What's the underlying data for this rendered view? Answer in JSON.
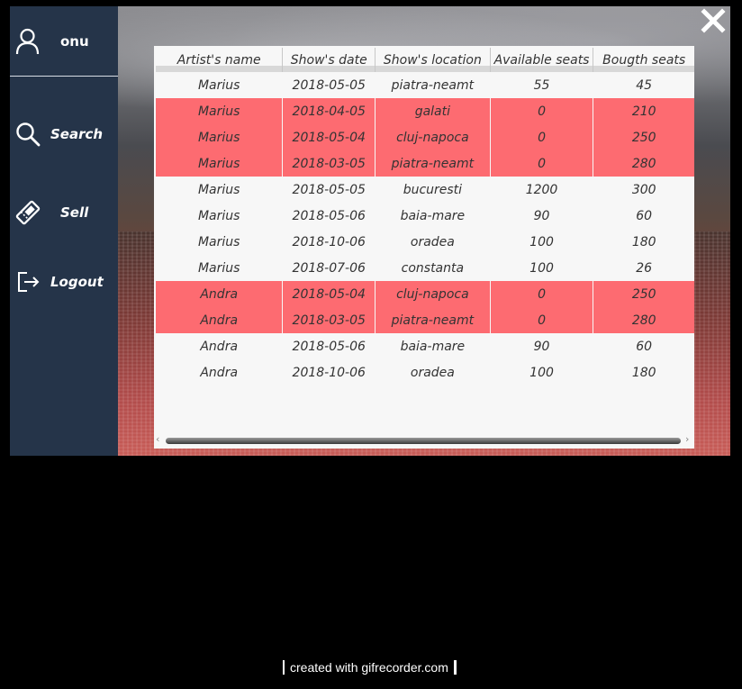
{
  "sidebar": {
    "user_name": "onu",
    "items": [
      {
        "label": "Search",
        "icon": "search-icon"
      },
      {
        "label": "Sell",
        "icon": "ticket-icon"
      },
      {
        "label": "Logout",
        "icon": "logout-icon"
      }
    ]
  },
  "window": {
    "close_icon": "close-icon"
  },
  "table": {
    "columns": [
      "Artist's name",
      "Show's date",
      "Show's location",
      "Available seats",
      "Bougth seats"
    ],
    "rows": [
      {
        "artist": "Marius",
        "date": "2018-05-05",
        "location": "piatra-neamt",
        "available": "55",
        "bought": "45",
        "sold_out": false
      },
      {
        "artist": "Marius",
        "date": "2018-04-05",
        "location": "galati",
        "available": "0",
        "bought": "210",
        "sold_out": true
      },
      {
        "artist": "Marius",
        "date": "2018-05-04",
        "location": "cluj-napoca",
        "available": "0",
        "bought": "250",
        "sold_out": true
      },
      {
        "artist": "Marius",
        "date": "2018-03-05",
        "location": "piatra-neamt",
        "available": "0",
        "bought": "280",
        "sold_out": true
      },
      {
        "artist": "Marius",
        "date": "2018-05-05",
        "location": "bucuresti",
        "available": "1200",
        "bought": "300",
        "sold_out": false
      },
      {
        "artist": "Marius",
        "date": "2018-05-06",
        "location": "baia-mare",
        "available": "90",
        "bought": "60",
        "sold_out": false
      },
      {
        "artist": "Marius",
        "date": "2018-10-06",
        "location": "oradea",
        "available": "100",
        "bought": "180",
        "sold_out": false
      },
      {
        "artist": "Marius",
        "date": "2018-07-06",
        "location": "constanta",
        "available": "100",
        "bought": "26",
        "sold_out": false
      },
      {
        "artist": "Andra",
        "date": "2018-05-04",
        "location": "cluj-napoca",
        "available": "0",
        "bought": "250",
        "sold_out": true
      },
      {
        "artist": "Andra",
        "date": "2018-03-05",
        "location": "piatra-neamt",
        "available": "0",
        "bought": "280",
        "sold_out": true
      },
      {
        "artist": "Andra",
        "date": "2018-05-06",
        "location": "baia-mare",
        "available": "90",
        "bought": "60",
        "sold_out": false
      },
      {
        "artist": "Andra",
        "date": "2018-10-06",
        "location": "oradea",
        "available": "100",
        "bought": "180",
        "sold_out": false
      }
    ]
  },
  "colors": {
    "sidebar_bg": "#253449",
    "sold_out_row": "#fd6b71",
    "panel_bg": "#f7f7f7"
  },
  "footer": {
    "credit": "created with gifrecorder.com"
  }
}
